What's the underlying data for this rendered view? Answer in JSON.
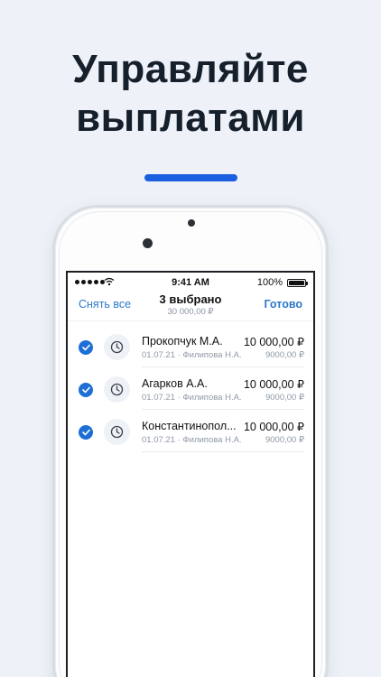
{
  "headline": {
    "line1": "Управляйте",
    "line2": "выплатами"
  },
  "status_bar": {
    "time": "9:41 AM",
    "battery": "100%"
  },
  "nav": {
    "left_action": "Снять все",
    "title": "3 выбрано",
    "subtitle": "30 000,00 ₽",
    "right_action": "Готово"
  },
  "payments": [
    {
      "name": "Прокопчук М.А.",
      "amount": "10 000,00 ₽",
      "meta": "01.07.21 · Филипова Н.А.",
      "sub_amount": "9000,00 ₽",
      "checked": true,
      "status_icon": "clock-icon"
    },
    {
      "name": "Агарков А.А.",
      "amount": "10 000,00 ₽",
      "meta": "01.07.21 · Филипова Н.А.",
      "sub_amount": "9000,00 ₽",
      "checked": true,
      "status_icon": "clock-icon"
    },
    {
      "name": "Константинопол...",
      "amount": "10 000,00 ₽",
      "meta": "01.07.21 · Филипова Н.А.",
      "sub_amount": "9000,00 ₽",
      "checked": true,
      "status_icon": "clock-icon"
    }
  ],
  "colors": {
    "background": "#eef2f8",
    "accent_bar": "#1a5fe0",
    "link": "#2b79c9",
    "checkbox": "#1d6fd6"
  }
}
